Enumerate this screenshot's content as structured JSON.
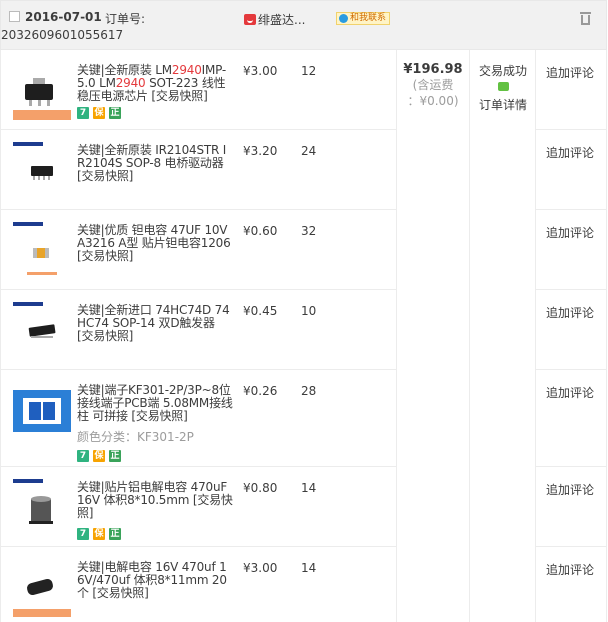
{
  "order": {
    "date": "2016-07-01",
    "order_no_label": "订单号:",
    "order_no": "2032609601055617",
    "shop_name": "绯盛达...",
    "ww_label": "和我联系",
    "total": "¥196.98",
    "shipping_line1": "(含运费",
    "shipping_line2": "：¥0.00)",
    "status": "交易成功",
    "detail_link": "订单详情"
  },
  "items": [
    {
      "title_parts": [
        "关键|全新原装 LM",
        "2940",
        "IMP-5.0 LM",
        "2940",
        " SOT-223 线性稳压电源芯片 [交易快照]"
      ],
      "price": "¥3.00",
      "qty": "12",
      "review": "追加评论",
      "thumb_icon": "chip-sot223-thumbnail"
    },
    {
      "title": "关键|全新原装 IR2104STR IR2104S SOP-8 电桥驱动器 [交易快照]",
      "price": "¥3.20",
      "qty": "24",
      "review": "追加评论",
      "thumb_icon": "chip-sop8-thumbnail"
    },
    {
      "title": "关键|优质 钽电容 47UF 10V A3216 A型 贴片钽电容1206 [交易快照]",
      "price": "¥0.60",
      "qty": "32",
      "review": "追加评论",
      "thumb_icon": "tantalum-capacitor-thumbnail"
    },
    {
      "title": "关键|全新进口 74HC74D 74HC74 SOP-14 双D触发器 [交易快照]",
      "price": "¥0.45",
      "qty": "10",
      "review": "追加评论",
      "thumb_icon": "chip-sop14-thumbnail"
    },
    {
      "title": "关键|端子KF301-2P/3P~8位接线端子PCB端 5.08MM接线柱 可拼接 [交易快照]",
      "sku_label": "颜色分类：",
      "sku_value": "KF301-2P",
      "price": "¥0.26",
      "qty": "28",
      "review": "追加评论",
      "thumb_icon": "terminal-block-thumbnail"
    },
    {
      "title": "关键|贴片铝电解电容 470uF 16V 体积8*10.5mm [交易快照]",
      "price": "¥0.80",
      "qty": "14",
      "review": "追加评论",
      "thumb_icon": "smd-electrolytic-capacitor-thumbnail"
    },
    {
      "title": "关键|电解电容 16V 470uf 16V/470uf 体积8*11mm 20个 [交易快照]",
      "price": "¥3.00",
      "qty": "14",
      "review": "追加评论",
      "thumb_icon": "electrolytic-capacitor-thumbnail"
    }
  ],
  "badges": [
    "7",
    "保",
    "正"
  ],
  "colors": {
    "highlight": "#e4393c",
    "header_bg": "#f1f1f1",
    "badge_green": "#2fb380",
    "badge_orange": "#f7a300"
  }
}
